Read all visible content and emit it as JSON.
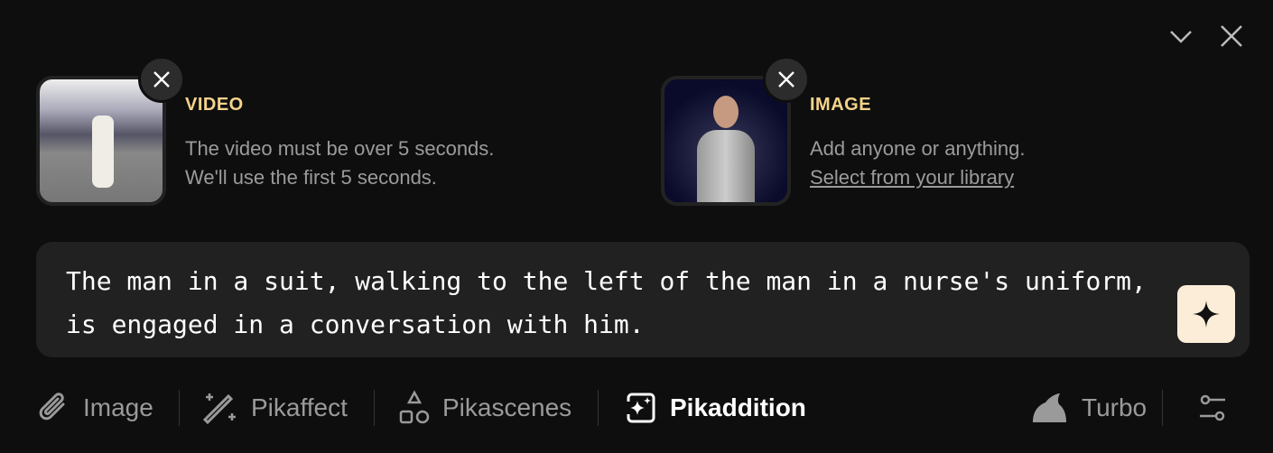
{
  "header": {
    "collapse_icon": "chevron-down-icon",
    "close_icon": "close-icon"
  },
  "video": {
    "label": "VIDEO",
    "line1": "The video must be over 5 seconds.",
    "line2": "We'll use the first 5 seconds."
  },
  "image": {
    "label": "IMAGE",
    "line1": "Add anyone or anything.",
    "link": "Select from your library"
  },
  "prompt": {
    "text": "The man in a suit, walking to the left of the man in a nurse's uniform, is engaged in a conversation with him."
  },
  "toolbar": {
    "image": "Image",
    "pikaffect": "Pikaffect",
    "pikascenes": "Pikascenes",
    "pikaddition": "Pikaddition",
    "turbo": "Turbo"
  },
  "colors": {
    "accent_label": "#f5d38b",
    "generate_bg": "#fbedd8",
    "background": "#0e0e0e",
    "prompt_bg": "#212121"
  }
}
